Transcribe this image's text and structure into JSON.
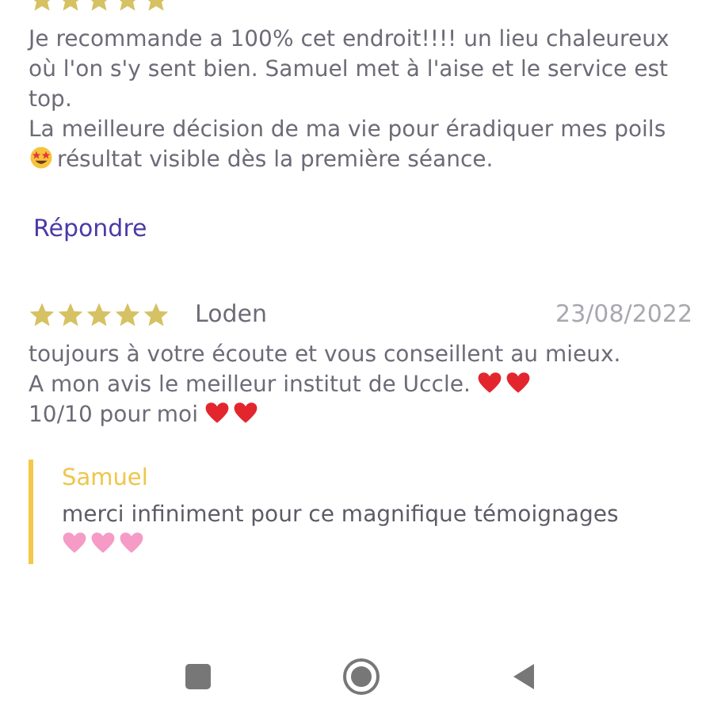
{
  "reviews": [
    {
      "stars": 5,
      "paragraphs": [
        [
          {
            "kind": "text",
            "text": "Je recommande a 100% cet endroit!!!! un lieu chaleureux où l'on s'y sent bien. Samuel met à l'aise et le service est top."
          }
        ],
        [
          {
            "kind": "text",
            "text": "La meilleure décision de ma vie pour éradiquer mes poils"
          },
          {
            "kind": "star-eyes"
          },
          {
            "kind": "text",
            "text": "résultat visible dès la première séance."
          }
        ]
      ],
      "reply_link": "Répondre"
    },
    {
      "stars": 5,
      "author": "Loden",
      "date": "23/08/2022",
      "paragraphs": [
        [
          {
            "kind": "text",
            "text": "toujours à votre écoute et vous conseillent au mieux."
          }
        ],
        [
          {
            "kind": "text",
            "text": "A mon avis le meilleur institut de Uccle."
          },
          {
            "kind": "red-heart"
          },
          {
            "kind": "red-heart"
          },
          {
            "kind": "text",
            "text": "10/10 pour"
          },
          {
            "kind": "text",
            "text": "moi"
          },
          {
            "kind": "red-heart"
          },
          {
            "kind": "red-heart"
          }
        ]
      ],
      "response": {
        "author": "Samuel",
        "paragraphs": [
          [
            {
              "kind": "text",
              "text": "merci infiniment pour ce magnifique témoignages"
            },
            {
              "kind": "pink-heart"
            },
            {
              "kind": "pink-heart"
            },
            {
              "kind": "pink-heart"
            }
          ]
        ]
      }
    }
  ],
  "nav_bar": {
    "buttons": [
      {
        "kind": "recents"
      },
      {
        "kind": "home"
      },
      {
        "kind": "back"
      }
    ]
  }
}
